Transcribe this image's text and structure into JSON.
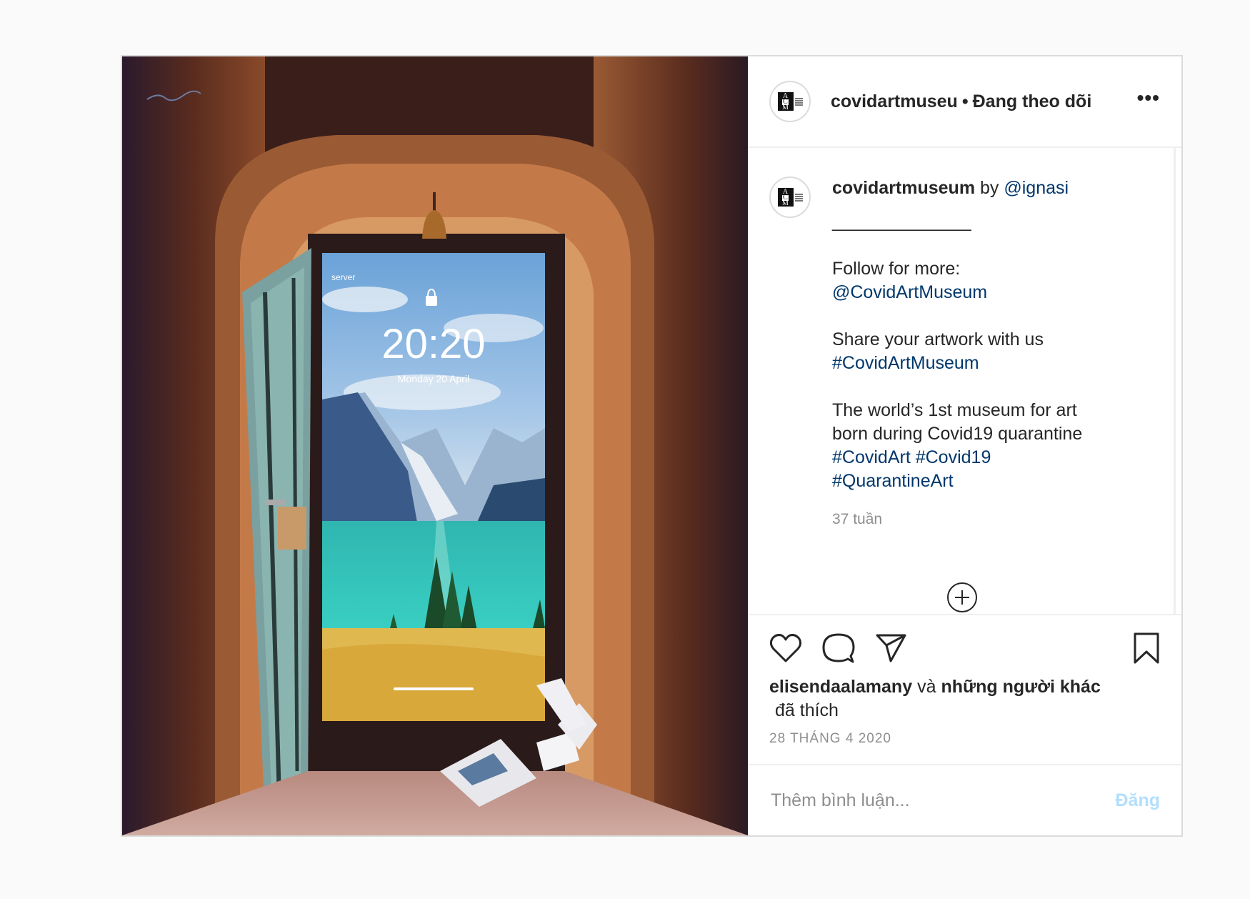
{
  "artwork": {
    "phone_carrier": "server",
    "phone_time": "20:20",
    "phone_date": "Monday 20 April"
  },
  "header": {
    "username": "covidartmuseu",
    "separator": "•",
    "follow_status": "Đang theo dõi",
    "more_icon": "more-horizontal-icon"
  },
  "caption": {
    "username": "covidartmuseum",
    "by_text": "by",
    "credit": "@ignasi",
    "divider": "______________",
    "follow_text": "Follow for more:",
    "follow_handle": "@CovidArtMuseum",
    "share_text": "Share your artwork with us",
    "share_tag": "#CovidArtMuseum",
    "about_line1": "The world’s 1st museum for art",
    "about_line2": "born during Covid19 quarantine",
    "tags_line1_a": "#CovidArt",
    "tags_line1_b": "#Covid19",
    "tags_line2": "#QuarantineArt",
    "time_ago": "37 tuần"
  },
  "actions": {
    "icons": [
      "heart-icon",
      "comment-icon",
      "share-icon",
      "bookmark-icon"
    ]
  },
  "likes": {
    "user": "elisendaalamany",
    "connector": "và",
    "others": "những người khác",
    "suffix": "đã thích"
  },
  "post_date": "28 THÁNG 4 2020",
  "comment": {
    "placeholder": "Thêm bình luận...",
    "post_label": "Đăng"
  },
  "colors": {
    "link": "#00376b",
    "post_button_disabled": "#b2dffc",
    "muted": "#8e8e8e",
    "border": "#dbdbdb"
  }
}
